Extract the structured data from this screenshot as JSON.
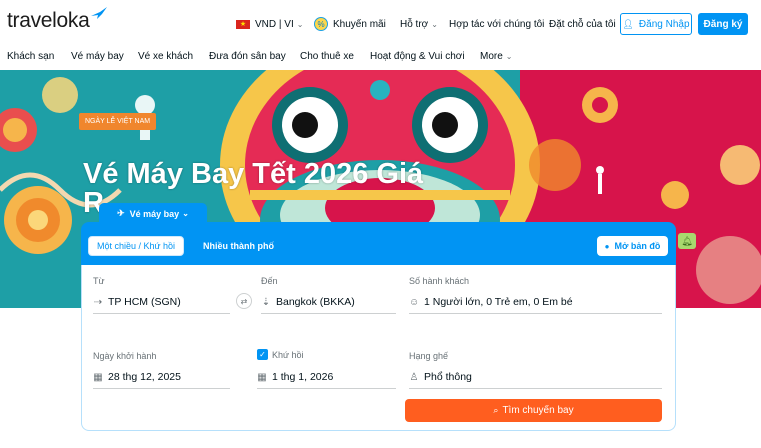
{
  "header": {
    "logo_text": "traveloka",
    "currency_language": "VND | VI",
    "promotions": "Khuyến mãi",
    "support": "Hỗ trợ",
    "partner": "Hợp tác với chúng tôi",
    "my_bookings": "Đặt chỗ của tôi",
    "login": "Đăng Nhập",
    "register": "Đăng ký"
  },
  "category_nav": [
    "Khách sạn",
    "Vé máy bay",
    "Vé xe khách",
    "Đưa đón sân bay",
    "Cho thuê xe",
    "Hoạt động & Vui chơi",
    "More"
  ],
  "hero": {
    "badge": "NGÀY LỄ VIỆT NAM",
    "title_line1": "Vé Máy Bay Tết 2026 Giá",
    "title_line2": "R"
  },
  "search_widget": {
    "product_tab": "Vé máy bay",
    "trip_types": {
      "one_way_round": "Một chiều / Khứ hồi",
      "multi_city": "Nhiều thành phố"
    },
    "map_button": "Mở bản đồ",
    "from": {
      "label": "Từ",
      "value": "TP HCM (SGN)"
    },
    "to": {
      "label": "Đến",
      "value": "Bangkok (BKKA)"
    },
    "passengers": {
      "label": "Số hành khách",
      "value": "1 Người lớn, 0 Trẻ em, 0 Em bé"
    },
    "departure": {
      "label": "Ngày khởi hành",
      "value": "28 thg 12, 2025"
    },
    "return": {
      "label": "Khứ hồi",
      "value": "1 thg 1, 2026",
      "checked": true
    },
    "seat_class": {
      "label": "Hạng ghế",
      "value": "Phổ thông"
    },
    "search_button": "Tìm chuyến bay"
  },
  "colors": {
    "brand_blue": "#0194f3",
    "search_orange": "#ff5e1f",
    "hero_teal": "#1e9fa6",
    "hero_red": "#d7144b"
  },
  "icons": [
    "bird-logo-icon",
    "vietnam-flag-icon",
    "promo-icon",
    "chevron-down-icon",
    "user-icon",
    "plane-icon",
    "map-pin-icon",
    "bell-icon",
    "plane-takeoff-icon",
    "plane-landing-icon",
    "swap-icon",
    "passengers-icon",
    "calendar-icon",
    "seat-icon",
    "search-icon"
  ]
}
